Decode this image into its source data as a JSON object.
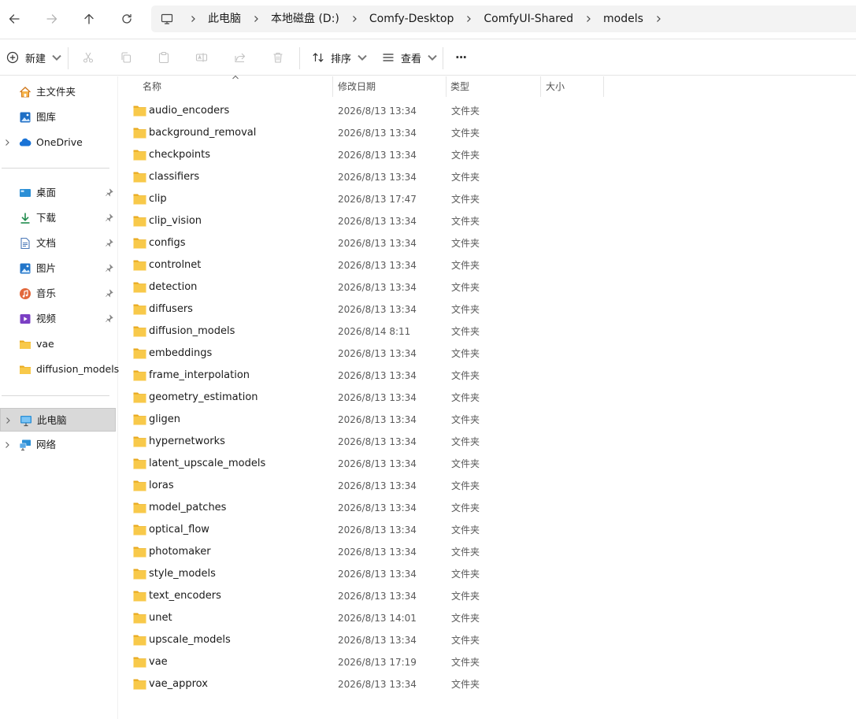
{
  "address_bar": {
    "back_icon": "arrow-left-icon",
    "forward_icon": "arrow-right-icon",
    "up_icon": "arrow-up-icon",
    "refresh_icon": "refresh-icon",
    "crumbs": [
      "此电脑",
      "本地磁盘 (D:)",
      "Comfy-Desktop",
      "ComfyUI-Shared",
      "models"
    ]
  },
  "toolbar": {
    "new_label": "新建",
    "sort_label": "排序",
    "view_label": "查看",
    "more_label": "···"
  },
  "sidebar": {
    "home": "主文件夹",
    "gallery": "图库",
    "onedrive": "OneDrive",
    "quick_access": [
      {
        "label": "桌面",
        "icon": "desktop-icon"
      },
      {
        "label": "下载",
        "icon": "download-icon"
      },
      {
        "label": "文档",
        "icon": "documents-icon"
      },
      {
        "label": "图片",
        "icon": "pictures-icon"
      },
      {
        "label": "音乐",
        "icon": "music-icon"
      },
      {
        "label": "视频",
        "icon": "videos-icon"
      },
      {
        "label": "vae",
        "icon": "folder-icon"
      },
      {
        "label": "diffusion_models",
        "icon": "folder-icon"
      }
    ],
    "this_pc": "此电脑",
    "network": "网络"
  },
  "columns": {
    "name": "名称",
    "modified": "修改日期",
    "type": "类型",
    "size": "大小"
  },
  "files": [
    {
      "name": "audio_encoders",
      "modified": "2026/8/13 13:34",
      "type": "文件夹"
    },
    {
      "name": "background_removal",
      "modified": "2026/8/13 13:34",
      "type": "文件夹"
    },
    {
      "name": "checkpoints",
      "modified": "2026/8/13 13:34",
      "type": "文件夹"
    },
    {
      "name": "classifiers",
      "modified": "2026/8/13 13:34",
      "type": "文件夹"
    },
    {
      "name": "clip",
      "modified": "2026/8/13 17:47",
      "type": "文件夹"
    },
    {
      "name": "clip_vision",
      "modified": "2026/8/13 13:34",
      "type": "文件夹"
    },
    {
      "name": "configs",
      "modified": "2026/8/13 13:34",
      "type": "文件夹"
    },
    {
      "name": "controlnet",
      "modified": "2026/8/13 13:34",
      "type": "文件夹"
    },
    {
      "name": "detection",
      "modified": "2026/8/13 13:34",
      "type": "文件夹"
    },
    {
      "name": "diffusers",
      "modified": "2026/8/13 13:34",
      "type": "文件夹"
    },
    {
      "name": "diffusion_models",
      "modified": "2026/8/14 8:11",
      "type": "文件夹"
    },
    {
      "name": "embeddings",
      "modified": "2026/8/13 13:34",
      "type": "文件夹"
    },
    {
      "name": "frame_interpolation",
      "modified": "2026/8/13 13:34",
      "type": "文件夹"
    },
    {
      "name": "geometry_estimation",
      "modified": "2026/8/13 13:34",
      "type": "文件夹"
    },
    {
      "name": "gligen",
      "modified": "2026/8/13 13:34",
      "type": "文件夹"
    },
    {
      "name": "hypernetworks",
      "modified": "2026/8/13 13:34",
      "type": "文件夹"
    },
    {
      "name": "latent_upscale_models",
      "modified": "2026/8/13 13:34",
      "type": "文件夹"
    },
    {
      "name": "loras",
      "modified": "2026/8/13 13:34",
      "type": "文件夹"
    },
    {
      "name": "model_patches",
      "modified": "2026/8/13 13:34",
      "type": "文件夹"
    },
    {
      "name": "optical_flow",
      "modified": "2026/8/13 13:34",
      "type": "文件夹"
    },
    {
      "name": "photomaker",
      "modified": "2026/8/13 13:34",
      "type": "文件夹"
    },
    {
      "name": "style_models",
      "modified": "2026/8/13 13:34",
      "type": "文件夹"
    },
    {
      "name": "text_encoders",
      "modified": "2026/8/13 13:34",
      "type": "文件夹"
    },
    {
      "name": "unet",
      "modified": "2026/8/13 14:01",
      "type": "文件夹"
    },
    {
      "name": "upscale_models",
      "modified": "2026/8/13 13:34",
      "type": "文件夹"
    },
    {
      "name": "vae",
      "modified": "2026/8/13 17:19",
      "type": "文件夹"
    },
    {
      "name": "vae_approx",
      "modified": "2026/8/13 13:34",
      "type": "文件夹"
    }
  ],
  "colors": {
    "folder": "#f8c94a",
    "folder_dark": "#e8a91e",
    "selected_bg": "#d9d9d9",
    "accent": "#0067c0"
  }
}
